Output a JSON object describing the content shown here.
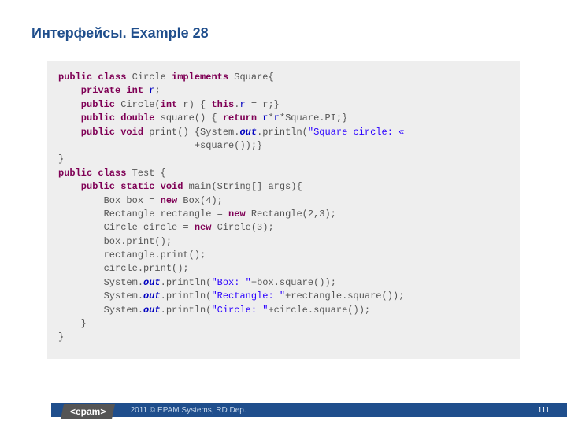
{
  "title": "Интерфейсы. Example 28",
  "footer": {
    "copyright": "2011 © EPAM Systems, RD Dep.",
    "page": "111",
    "logo": "<epam>"
  },
  "code": {
    "l1": {
      "a": "public class",
      "b": " Circle ",
      "c": "implements",
      "d": " Square{"
    },
    "l2": {
      "a": "    private int",
      "b": " ",
      "c": "r",
      "d": ";"
    },
    "l3": {
      "a": "    public",
      "b": " Circle(",
      "c": "int",
      "d": " r) { ",
      "e": "this",
      "f": ".",
      "g": "r",
      "h": " = r;}"
    },
    "l4": {
      "a": "    public double",
      "b": " square() { ",
      "c": "return",
      "d": " ",
      "e": "r",
      "f": "*",
      "g": "r",
      "h": "*Square.PI;}"
    },
    "l5": {
      "a": "    public void",
      "b": " print() {System.",
      "c": "out",
      "d": ".println(",
      "e": "\"Square circle: «",
      "f": ""
    },
    "l5b": {
      "a": "                        +square());}"
    },
    "l6": {
      "a": "}"
    },
    "l7": {
      "a": "public class",
      "b": " Test {"
    },
    "l8": {
      "a": "    public static void",
      "b": " main(String[] args){"
    },
    "l9": {
      "a": "        Box box = ",
      "b": "new",
      "c": " Box(4);"
    },
    "l10": {
      "a": "        Rectangle rectangle = ",
      "b": "new",
      "c": " Rectangle(2,3);"
    },
    "l11": {
      "a": "        Circle circle = ",
      "b": "new",
      "c": " Circle(3);"
    },
    "l12": {
      "a": "        box.print();"
    },
    "l13": {
      "a": "        rectangle.print();"
    },
    "l14": {
      "a": "        circle.print();"
    },
    "l15": {
      "a": "        System.",
      "b": "out",
      "c": ".println(",
      "d": "\"Box: \"",
      "e": "+box.square());"
    },
    "l16": {
      "a": "        System.",
      "b": "out",
      "c": ".println(",
      "d": "\"Rectangle: \"",
      "e": "+rectangle.square());"
    },
    "l17": {
      "a": "        System.",
      "b": "out",
      "c": ".println(",
      "d": "\"Circle: \"",
      "e": "+circle.square());"
    },
    "l18": {
      "a": "    }"
    },
    "l19": {
      "a": "}"
    }
  }
}
